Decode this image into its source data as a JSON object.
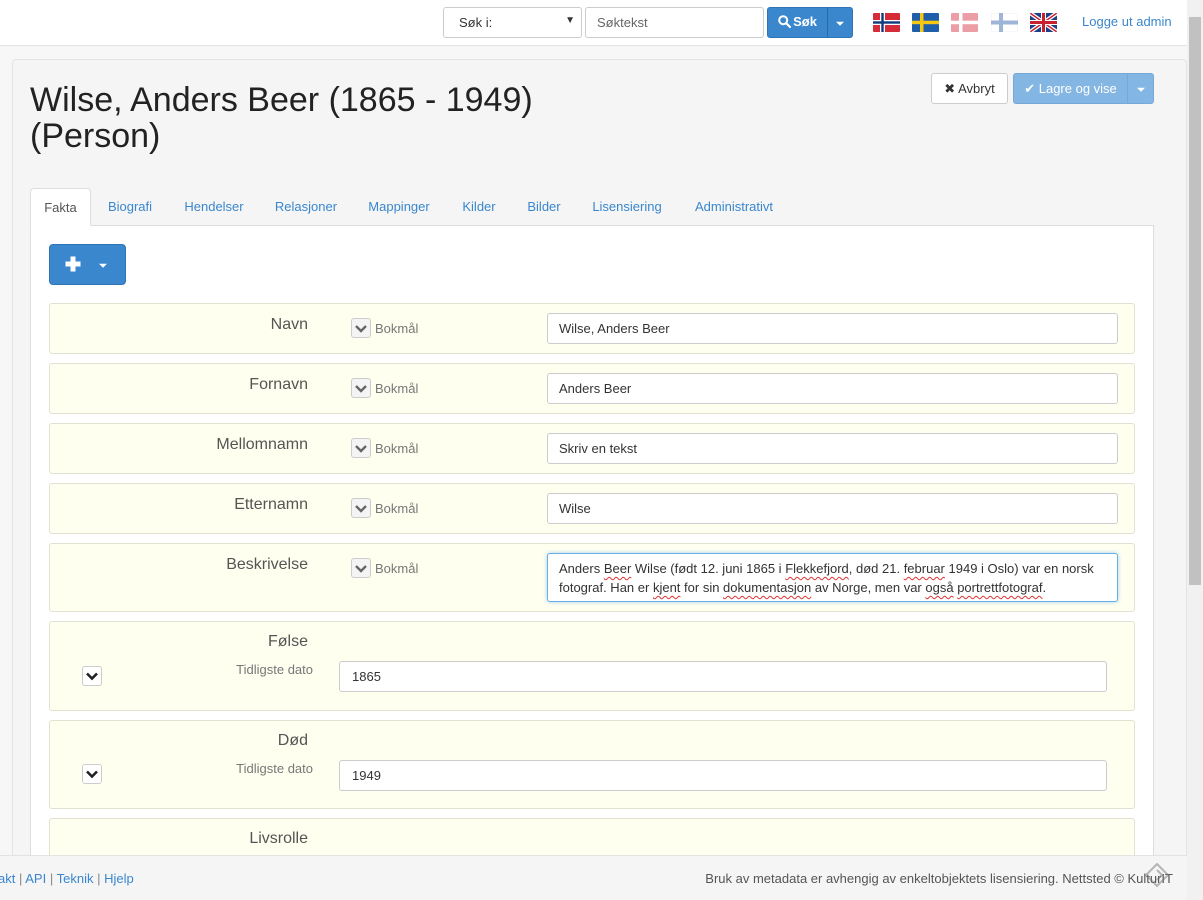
{
  "header": {
    "search_select_label": "Søk i:",
    "search_placeholder": "Søktekst",
    "search_button": "Søk",
    "logout": "Logge ut admin",
    "flags": [
      "Norsk",
      "Svenska",
      "Dansk",
      "Suomi",
      "English"
    ]
  },
  "page": {
    "title": "Wilse, Anders Beer (1865 - 1949) (Person)",
    "cancel_button": "Avbryt",
    "save_button": "Lagre og vise"
  },
  "tabs": [
    {
      "label": "Fakta",
      "active": true
    },
    {
      "label": "Biografi"
    },
    {
      "label": "Hendelser"
    },
    {
      "label": "Relasjoner"
    },
    {
      "label": "Mappinger"
    },
    {
      "label": "Kilder"
    },
    {
      "label": "Bilder"
    },
    {
      "label": "Lisensiering"
    },
    {
      "label": "Administrativt"
    }
  ],
  "fields": [
    {
      "label": "Navn",
      "language": "Bokmål",
      "value": "Wilse, Anders Beer"
    },
    {
      "label": "Fornavn",
      "language": "Bokmål",
      "value": "Anders Beer"
    },
    {
      "label": "Mellomnamn",
      "language": "Bokmål",
      "value": "Skriv en tekst"
    },
    {
      "label": "Etternamn",
      "language": "Bokmål",
      "value": "Wilse"
    },
    {
      "label": "Beskrivelse",
      "language": "Bokmål",
      "value": "Anders Beer Wilse (født 12. juni 1865 i Flekkefjord, død 21. februar 1949 i Oslo) var en norsk fotograf. Han er kjent for sin dokumentasjon av Norge, men var også portrettfotograf."
    }
  ],
  "dates": [
    {
      "label": "Følse",
      "sublabel": "Tidligste dato",
      "value": "1865"
    },
    {
      "label": "Død",
      "sublabel": "Tidligste dato",
      "value": "1949"
    }
  ],
  "livsrolle": {
    "label": "Livsrolle"
  },
  "footer": {
    "links": [
      "akt",
      "API",
      "Teknik",
      "Hjelp"
    ],
    "separator": "|",
    "note": "Bruk av metadata er avhengig av enkeltobjektets lisensiering. Nettsted © KulturIT"
  },
  "colors": {
    "primary": "#3a87cd",
    "save_disabled": "#84b6e3",
    "row_background": "#fffff0"
  }
}
